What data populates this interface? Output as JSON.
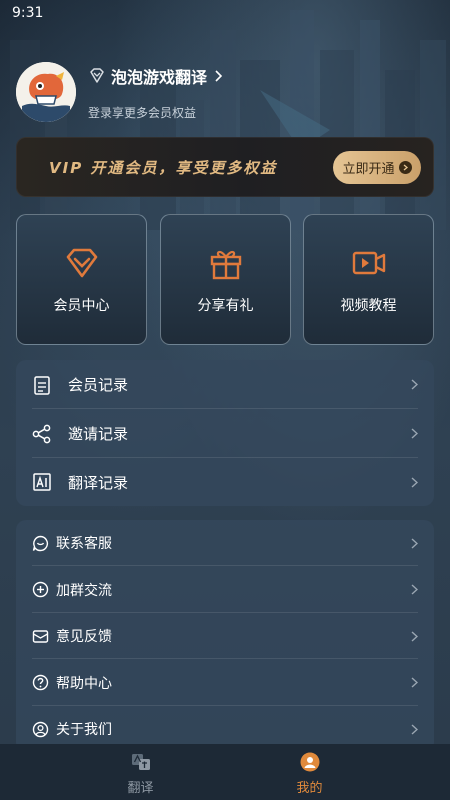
{
  "status_bar": {
    "time": "9:31"
  },
  "profile": {
    "username": "泡泡游戏翻译",
    "subtitle": "登录享更多会员权益",
    "avatar_icon": "mascot-avatar-icon",
    "badge_icon": "diamond-icon"
  },
  "vip_banner": {
    "text": "VIP 开通会员，享受更多权益",
    "button_label": "立即开通",
    "accent_color": "#e1b982"
  },
  "cards": [
    {
      "label": "会员中心",
      "icon": "diamond-icon"
    },
    {
      "label": "分享有礼",
      "icon": "gift-icon"
    },
    {
      "label": "视频教程",
      "icon": "video-icon"
    }
  ],
  "records": [
    {
      "label": "会员记录",
      "icon": "clipboard-icon"
    },
    {
      "label": "邀请记录",
      "icon": "share-icon"
    },
    {
      "label": "翻译记录",
      "icon": "translate-doc-icon"
    }
  ],
  "support": [
    {
      "label": "联系客服",
      "icon": "chat-icon"
    },
    {
      "label": "加群交流",
      "icon": "plus-circle-icon"
    },
    {
      "label": "意见反馈",
      "icon": "feedback-icon"
    },
    {
      "label": "帮助中心",
      "icon": "help-icon"
    },
    {
      "label": "关于我们",
      "icon": "user-circle-icon"
    }
  ],
  "tabbar": {
    "tabs": [
      {
        "label": "翻译",
        "icon": "translate-icon",
        "active": false
      },
      {
        "label": "我的",
        "icon": "profile-icon",
        "active": true
      }
    ],
    "active_color": "#e08a3c",
    "inactive_color": "#8e98a3"
  },
  "colors": {
    "icon_orange": "#e07a3c",
    "background": "#2b3b4b"
  }
}
